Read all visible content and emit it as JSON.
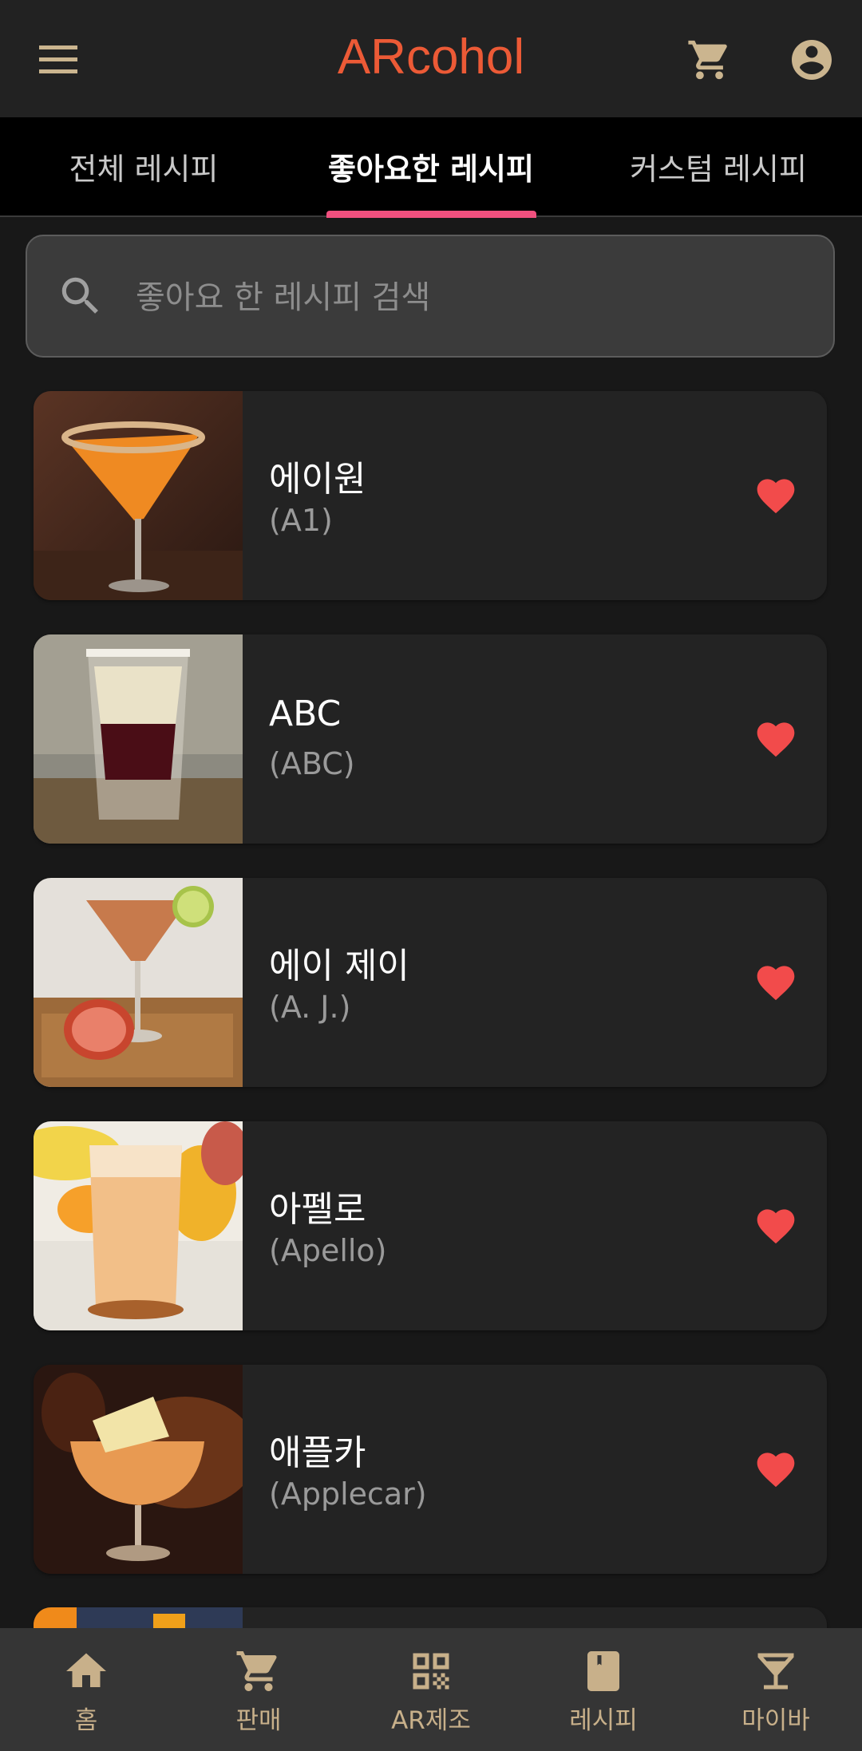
{
  "app_bar": {
    "title": "ARcohol",
    "menu_icon": "menu-icon",
    "cart_icon": "cart-icon",
    "account_icon": "account-circle-icon"
  },
  "tabs": [
    {
      "label": "전체 레시피",
      "active": false
    },
    {
      "label": "좋아요한 레시피",
      "active": true
    },
    {
      "label": "커스텀 레시피",
      "active": false
    }
  ],
  "search": {
    "placeholder": "좋아요 한 레시피 검색",
    "value": "",
    "icon": "search-icon"
  },
  "recipes": [
    {
      "name_ko": "에이원",
      "name_en": "(A1)",
      "liked": true
    },
    {
      "name_ko": "ABC",
      "name_en": "(ABC)",
      "liked": true
    },
    {
      "name_ko": "에이 제이",
      "name_en": "(A. J.)",
      "liked": true
    },
    {
      "name_ko": "아펠로",
      "name_en": "(Apello)",
      "liked": true
    },
    {
      "name_ko": "애플카",
      "name_en": "(Applecar)",
      "liked": true
    }
  ],
  "bottom_nav": [
    {
      "label": "홈",
      "icon": "home-icon"
    },
    {
      "label": "판매",
      "icon": "cart-icon"
    },
    {
      "label": "AR제조",
      "icon": "qr-code-icon"
    },
    {
      "label": "레시피",
      "icon": "book-icon"
    },
    {
      "label": "마이바",
      "icon": "cocktail-glass-icon"
    }
  ],
  "colors": {
    "brand": "#ec5a36",
    "tab_indicator": "#f0507e",
    "heart": "#f24b4b",
    "nav_accent": "#c8b08a",
    "icon_accent": "#cbb58f"
  }
}
